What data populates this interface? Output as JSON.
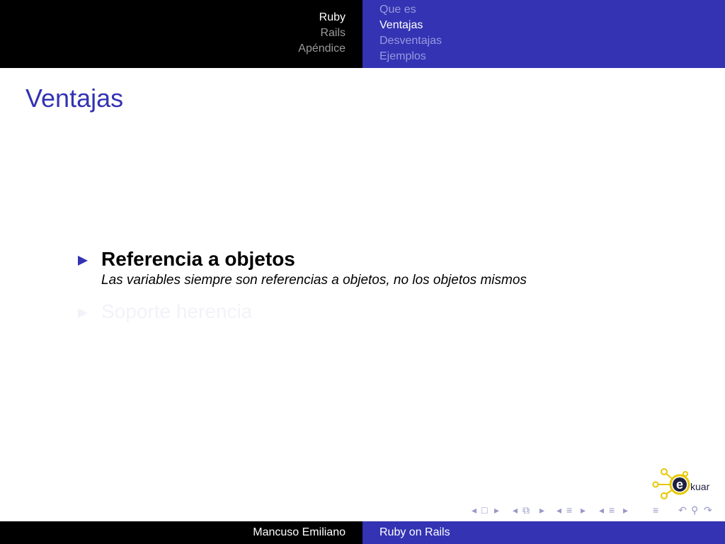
{
  "header": {
    "sections": [
      {
        "label": "Ruby",
        "active": true
      },
      {
        "label": "Rails",
        "active": false
      },
      {
        "label": "Apéndice",
        "active": false
      }
    ],
    "subsections": [
      {
        "label": "Que es",
        "active": false
      },
      {
        "label": "Ventajas",
        "active": true
      },
      {
        "label": "Desventajas",
        "active": false
      },
      {
        "label": "Ejemplos",
        "active": false
      }
    ]
  },
  "frame": {
    "title": "Ventajas",
    "items": [
      {
        "title": "Referencia a objetos",
        "description": "Las variables siempre son referencias a objetos, no los objetos mismos",
        "visible": true
      },
      {
        "title": "Soporte herencia",
        "description": "",
        "visible": false
      }
    ]
  },
  "logo": {
    "text": "kuar",
    "letter": "e"
  },
  "nav": {
    "icons": [
      "nav-prev-arrow",
      "frame-icon",
      "nav-next-arrow",
      "nav-prev-arrow",
      "subsection-icon",
      "nav-next-arrow",
      "nav-prev-arrow",
      "section-icon",
      "nav-next-arrow",
      "nav-prev-arrow",
      "section-icon",
      "nav-next-arrow",
      "appendix-icon",
      "search-icon"
    ]
  },
  "footer": {
    "author": "Mancuso Emiliano",
    "title": "Ruby on Rails"
  },
  "colors": {
    "accent": "#3333b3",
    "header_bg": "#000000",
    "faded_text": "#f2f2f8"
  }
}
